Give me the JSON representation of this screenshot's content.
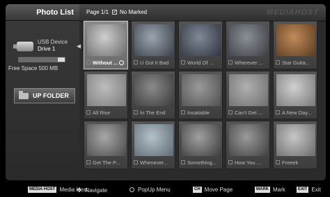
{
  "sidebar": {
    "title": "Photo List",
    "usb_label": "USB Device",
    "drive_label": "Drive 1",
    "usage_fraction": 0.85,
    "free_space": "Free Space 500 MB",
    "up_folder_label": "UP FOLDER"
  },
  "header": {
    "page_info": "Page 1/1",
    "marked_info": "No Marked",
    "brand": "MEDIAHOST"
  },
  "thumbnails": [
    {
      "label": "Without ...",
      "selected": true
    },
    {
      "label": "U Got It Bad",
      "selected": false
    },
    {
      "label": "World Of ...",
      "selected": false
    },
    {
      "label": "Wherever ...",
      "selected": false
    },
    {
      "label": "Star Guita...",
      "selected": false
    },
    {
      "label": "All Rise",
      "selected": false
    },
    {
      "label": "In The End",
      "selected": false
    },
    {
      "label": "Insatiable",
      "selected": false
    },
    {
      "label": "Can't Get ...",
      "selected": false
    },
    {
      "label": "A New Day...",
      "selected": false
    },
    {
      "label": "Get The P...",
      "selected": false
    },
    {
      "label": "Whenever...",
      "selected": false
    },
    {
      "label": "Something...",
      "selected": false
    },
    {
      "label": "How You ...",
      "selected": false
    },
    {
      "label": "Freeek",
      "selected": false
    }
  ],
  "footer": {
    "media_host_badge": "MEDIA HOST",
    "media_host_label": "Media Host",
    "navigate_label": "Navigate",
    "popup_label": "PopUp Menu",
    "move_page_label": "Move Page",
    "mark_badge": "MARK",
    "mark_label": "Mark",
    "exit_badge": "EXIT",
    "exit_label": "Exit"
  },
  "colors": {
    "background": "#000000",
    "panel": "#2b2b2b",
    "selected_frame": "#8a8a8a"
  }
}
